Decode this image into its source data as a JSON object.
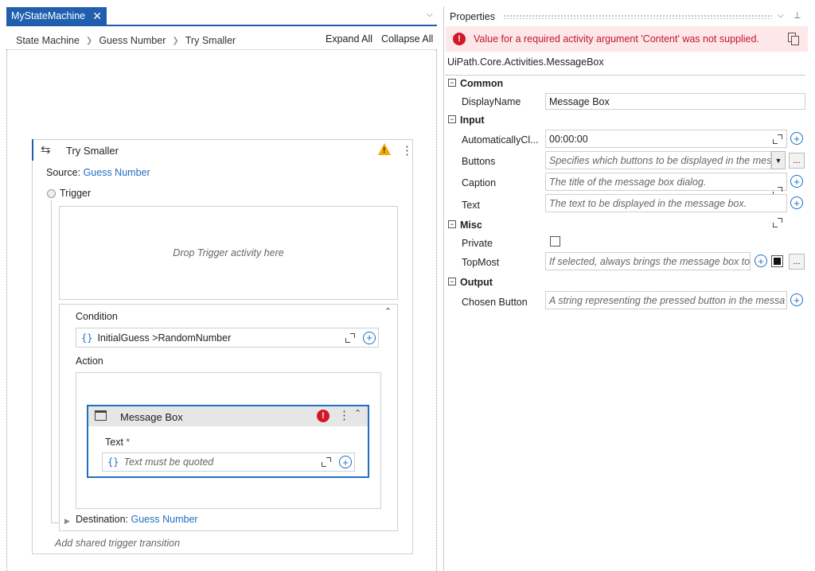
{
  "tab": {
    "title": "MyStateMachine",
    "close": "✕"
  },
  "breadcrumb": [
    "State Machine",
    "Guess Number",
    "Try Smaller"
  ],
  "toolbar": {
    "expand_all": "Expand All",
    "collapse_all": "Collapse All"
  },
  "state": {
    "title": "Try Smaller",
    "source_label": "Source:",
    "source_value": "Guess Number",
    "trigger_label": "Trigger",
    "drop_hint": "Drop Trigger activity here",
    "condition_label": "Condition",
    "condition_value": "InitialGuess >RandomNumber",
    "action_label": "Action",
    "destination_label": "Destination:",
    "destination_value": "Guess Number",
    "add_shared": "Add shared trigger transition"
  },
  "message_box": {
    "title": "Message Box",
    "text_label": "Text",
    "required": "*",
    "placeholder": "Text must be quoted"
  },
  "properties": {
    "title": "Properties",
    "error": "Value for a required activity argument 'Content' was not supplied.",
    "type_name": "UiPath.Core.Activities.MessageBox",
    "categories": {
      "common": "Common",
      "input": "Input",
      "misc": "Misc",
      "output": "Output"
    },
    "rows": {
      "display_name": {
        "label": "DisplayName",
        "value": "Message Box"
      },
      "auto_close": {
        "label": "AutomaticallyCl...",
        "value": "00:00:00"
      },
      "buttons": {
        "label": "Buttons",
        "placeholder": "Specifies which buttons to be displayed in the mes"
      },
      "caption": {
        "label": "Caption",
        "placeholder": "The title of the message box dialog."
      },
      "text": {
        "label": "Text",
        "placeholder": "The text to be displayed in the message box."
      },
      "private": {
        "label": "Private"
      },
      "topmost": {
        "label": "TopMost",
        "placeholder": "If selected, always brings the message box to"
      },
      "chosen_button": {
        "label": "Chosen Button",
        "placeholder": "A string representing the pressed button in the messa"
      }
    }
  },
  "colors": {
    "accent": "#1f5fae",
    "error": "#d1182b",
    "warning": "#f2a900"
  }
}
